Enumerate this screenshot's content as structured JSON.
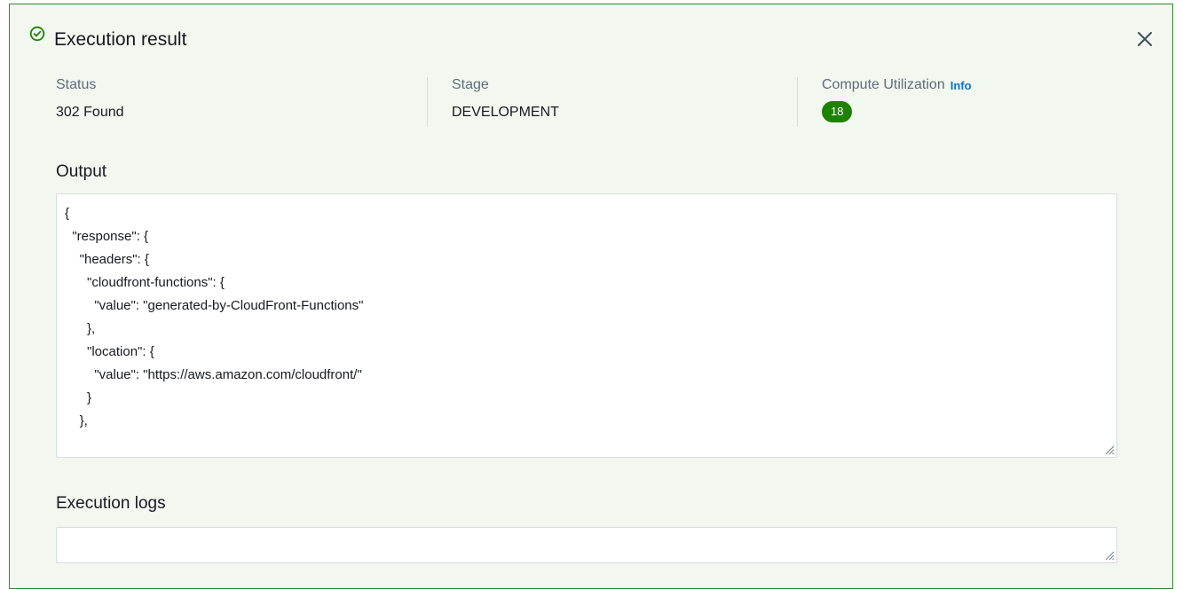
{
  "panel": {
    "title": "Execution result",
    "status": {
      "label": "Status",
      "value": "302 Found"
    },
    "stage": {
      "label": "Stage",
      "value": "DEVELOPMENT"
    },
    "compute": {
      "label": "Compute Utilization",
      "info": "Info",
      "value": "18"
    },
    "output": {
      "title": "Output",
      "lines": [
        "{",
        "  \"response\": {",
        "    \"headers\": {",
        "      \"cloudfront-functions\": {",
        "        \"value\": \"generated-by-CloudFront-Functions\"",
        "      },",
        "      \"location\": {",
        "        \"value\": \"https://aws.amazon.com/cloudfront/\"",
        "      }",
        "    },"
      ]
    },
    "logs": {
      "title": "Execution logs",
      "value": ""
    }
  },
  "icons": {
    "success": "check-circle-icon",
    "close": "close-icon",
    "resize": "resize-grip-icon"
  },
  "colors": {
    "success": "#1d8102",
    "border": "#2e8a2e",
    "background": "#f2f8f0",
    "link": "#0972d3"
  }
}
